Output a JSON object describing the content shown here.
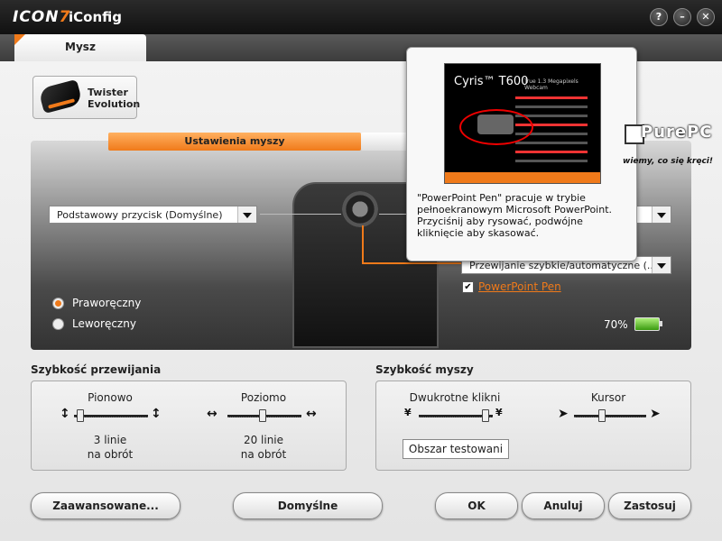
{
  "app": {
    "logo_main": "ICON",
    "logo_num": "7",
    "title": "iConfig"
  },
  "window": {
    "help": "?",
    "minimize": "–",
    "close": "✕"
  },
  "tabs": [
    {
      "label": "Mysz"
    }
  ],
  "device": {
    "name": "Twister Evolution"
  },
  "subtabs": [
    {
      "label": "Ustawienia myszy"
    }
  ],
  "left_select": {
    "value": "Podstawowy przycisk (Domyślne)"
  },
  "right_select": {
    "value": "Przewijanie szybkie/automatyczne (..."
  },
  "handedness": [
    {
      "label": "Praworęczny",
      "selected": true
    },
    {
      "label": "Leworęczny",
      "selected": false
    }
  ],
  "powerpoint_pen": {
    "label": "PowerPoint Pen",
    "checked": true
  },
  "battery": {
    "percent_label": "70%",
    "level": 0.7
  },
  "tooltip": {
    "slide_title": "Cyris™ T600",
    "slide_subtitle": "True 1.3 Megapixels Webcam",
    "text": "\"PowerPoint Pen\" pracuje w trybie pełnoekranowym Microsoft PowerPoint. Przyciśnij aby rysować, podwójne kliknięcie aby skasować."
  },
  "watermark": {
    "brand": "PurePC",
    "slogan": "wiemy, co się kręci!"
  },
  "scroll_speed": {
    "title": "Szybkość przewijania",
    "vertical": {
      "label": "Pionowo",
      "value": "3 linie",
      "unit": "na obrót"
    },
    "horizontal": {
      "label": "Poziomo",
      "value": "20 linie",
      "unit": "na obrót"
    }
  },
  "mouse_speed": {
    "title": "Szybkość myszy",
    "double_click": {
      "label": "Dwukrotne klikni"
    },
    "cursor": {
      "label": "Kursor"
    },
    "test_button": "Obszar testowani"
  },
  "buttons": {
    "advanced": "Zaawansowane...",
    "defaults": "Domyślne",
    "ok": "OK",
    "cancel": "Anuluj",
    "apply": "Zastosuj"
  }
}
